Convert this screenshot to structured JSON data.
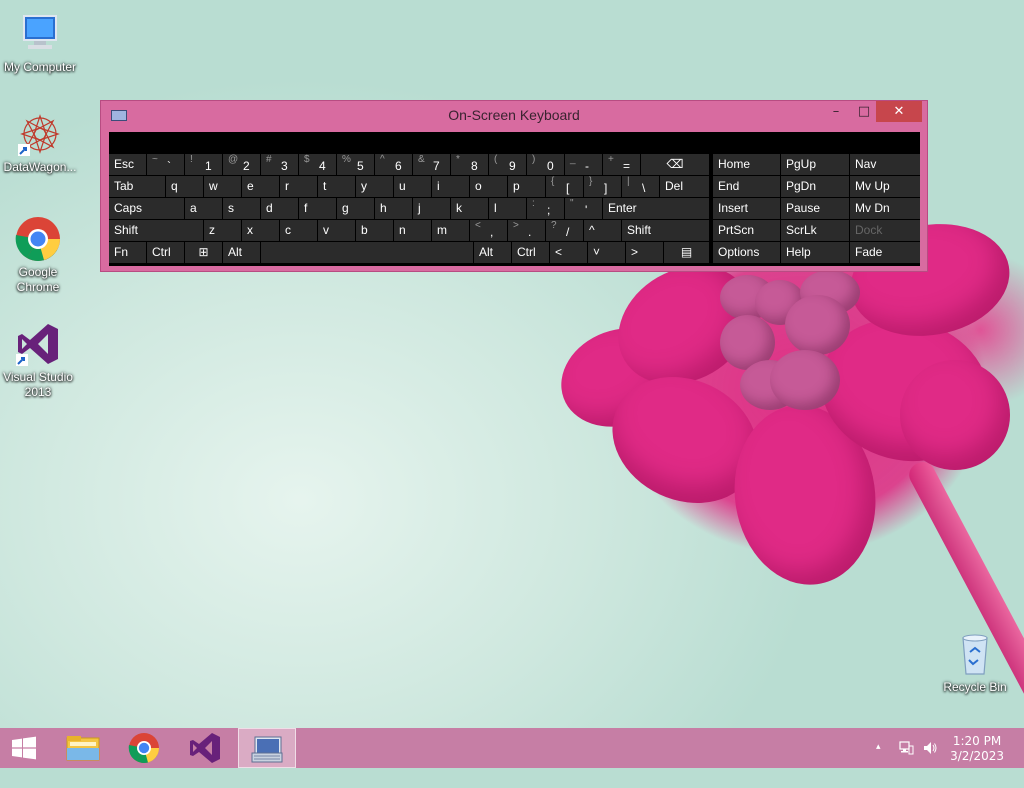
{
  "desktop": {
    "icons": [
      {
        "label": "My Computer",
        "icon": "computer-icon"
      },
      {
        "label": "DataWagon...",
        "icon": "datawagon-icon"
      },
      {
        "label": "Google Chrome",
        "icon": "chrome-icon"
      },
      {
        "label": "Visual Studio 2013",
        "icon": "visual-studio-icon"
      },
      {
        "label": "Recycle Bin",
        "icon": "recycle-bin-icon"
      }
    ]
  },
  "osk": {
    "title": "On-Screen Keyboard",
    "window_buttons": {
      "minimize": "–",
      "maximize": "□",
      "close": "✕"
    },
    "row1": [
      {
        "label": "Esc"
      },
      {
        "top": "~",
        "main": "`"
      },
      {
        "top": "!",
        "main": "1"
      },
      {
        "top": "@",
        "main": "2"
      },
      {
        "top": "#",
        "main": "3"
      },
      {
        "top": "$",
        "main": "4"
      },
      {
        "top": "%",
        "main": "5"
      },
      {
        "top": "^",
        "main": "6"
      },
      {
        "top": "&",
        "main": "7"
      },
      {
        "top": "*",
        "main": "8"
      },
      {
        "top": "(",
        "main": "9"
      },
      {
        "top": ")",
        "main": "0"
      },
      {
        "top": "_",
        "main": "-"
      },
      {
        "top": "+",
        "main": "="
      },
      {
        "label": "⌫",
        "icon": "backspace-icon"
      }
    ],
    "row2": [
      {
        "label": "Tab"
      },
      {
        "label": "q"
      },
      {
        "label": "w"
      },
      {
        "label": "e"
      },
      {
        "label": "r"
      },
      {
        "label": "t"
      },
      {
        "label": "y"
      },
      {
        "label": "u"
      },
      {
        "label": "i"
      },
      {
        "label": "o"
      },
      {
        "label": "p"
      },
      {
        "top": "{",
        "main": "["
      },
      {
        "top": "}",
        "main": "]"
      },
      {
        "top": "|",
        "main": "\\"
      },
      {
        "label": "Del"
      }
    ],
    "row3": [
      {
        "label": "Caps"
      },
      {
        "label": "a"
      },
      {
        "label": "s"
      },
      {
        "label": "d"
      },
      {
        "label": "f"
      },
      {
        "label": "g"
      },
      {
        "label": "h"
      },
      {
        "label": "j"
      },
      {
        "label": "k"
      },
      {
        "label": "l"
      },
      {
        "top": ":",
        "main": ";"
      },
      {
        "top": "\"",
        "main": "'"
      },
      {
        "label": "Enter"
      }
    ],
    "row4": [
      {
        "label": "Shift"
      },
      {
        "label": "z"
      },
      {
        "label": "x"
      },
      {
        "label": "c"
      },
      {
        "label": "v"
      },
      {
        "label": "b"
      },
      {
        "label": "n"
      },
      {
        "label": "m"
      },
      {
        "top": "<",
        "main": ","
      },
      {
        "top": ">",
        "main": "."
      },
      {
        "top": "?",
        "main": "/"
      },
      {
        "label": "^"
      },
      {
        "label": "Shift"
      }
    ],
    "row5": [
      {
        "label": "Fn"
      },
      {
        "label": "Ctrl"
      },
      {
        "label": "⊞",
        "icon": "windows-key-icon"
      },
      {
        "label": "Alt"
      },
      {
        "label": ""
      },
      {
        "label": "Alt"
      },
      {
        "label": "Ctrl"
      },
      {
        "label": "<"
      },
      {
        "label": "˅"
      },
      {
        "label": ">"
      },
      {
        "label": "▤",
        "icon": "menu-key-icon"
      }
    ],
    "nav": [
      [
        "Home",
        "PgUp",
        "Nav"
      ],
      [
        "End",
        "PgDn",
        "Mv Up"
      ],
      [
        "Insert",
        "Pause",
        "Mv Dn"
      ],
      [
        "PrtScn",
        "ScrLk",
        "Dock"
      ],
      [
        "Options",
        "Help",
        "Fade"
      ]
    ]
  },
  "taskbar": {
    "apps": [
      "start-icon",
      "file-explorer-icon",
      "chrome-icon",
      "visual-studio-icon",
      "on-screen-keyboard-icon"
    ],
    "clock": {
      "time": "1:20 PM",
      "date": "3/2/2023"
    },
    "tray": {
      "chevron": "▴"
    }
  }
}
